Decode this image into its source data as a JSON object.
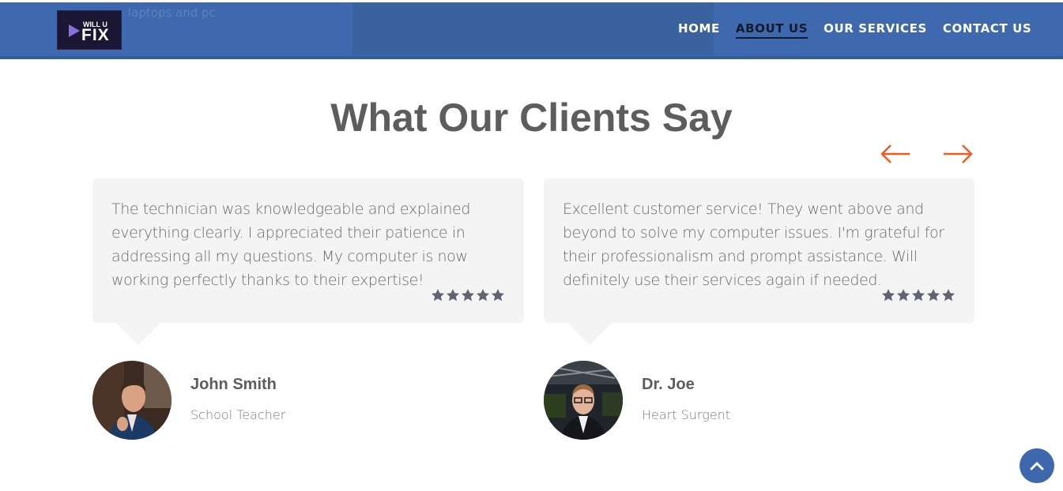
{
  "header": {
    "behind_text": "laptops and pc.",
    "logo": {
      "line1": "WILL U",
      "line2": "FIX"
    },
    "nav": [
      {
        "label": "HOME",
        "active": false
      },
      {
        "label": "ABOUT US",
        "active": true
      },
      {
        "label": "OUR SERVICES",
        "active": false
      },
      {
        "label": "CONTACT US",
        "active": false
      }
    ]
  },
  "testimonials": {
    "title": "What Our Clients Say",
    "prev_icon": "arrow-left-icon",
    "next_icon": "arrow-right-icon",
    "items": [
      {
        "quote": "The technician was knowledgeable and explained everything clearly. I appreciated their patience in addressing all my questions. My computer is now working perfectly thanks to their expertise!",
        "rating": 5,
        "name": "John Smith",
        "role": "School Teacher"
      },
      {
        "quote": "Excellent customer service! They went above and beyond to solve my computer issues. I'm grateful for their professionalism and prompt assistance. Will definitely use their services again if needed.",
        "rating": 5,
        "name": "Dr. Joe",
        "role": "Heart Surgent"
      }
    ]
  },
  "scroll_top_icon": "chevron-up-icon",
  "colors": {
    "navbar": "#3f69ae",
    "accent_arrow": "#f05a1f",
    "title": "#5d5d5d",
    "card": "#f4f4f4",
    "stars": "#5f6470"
  }
}
